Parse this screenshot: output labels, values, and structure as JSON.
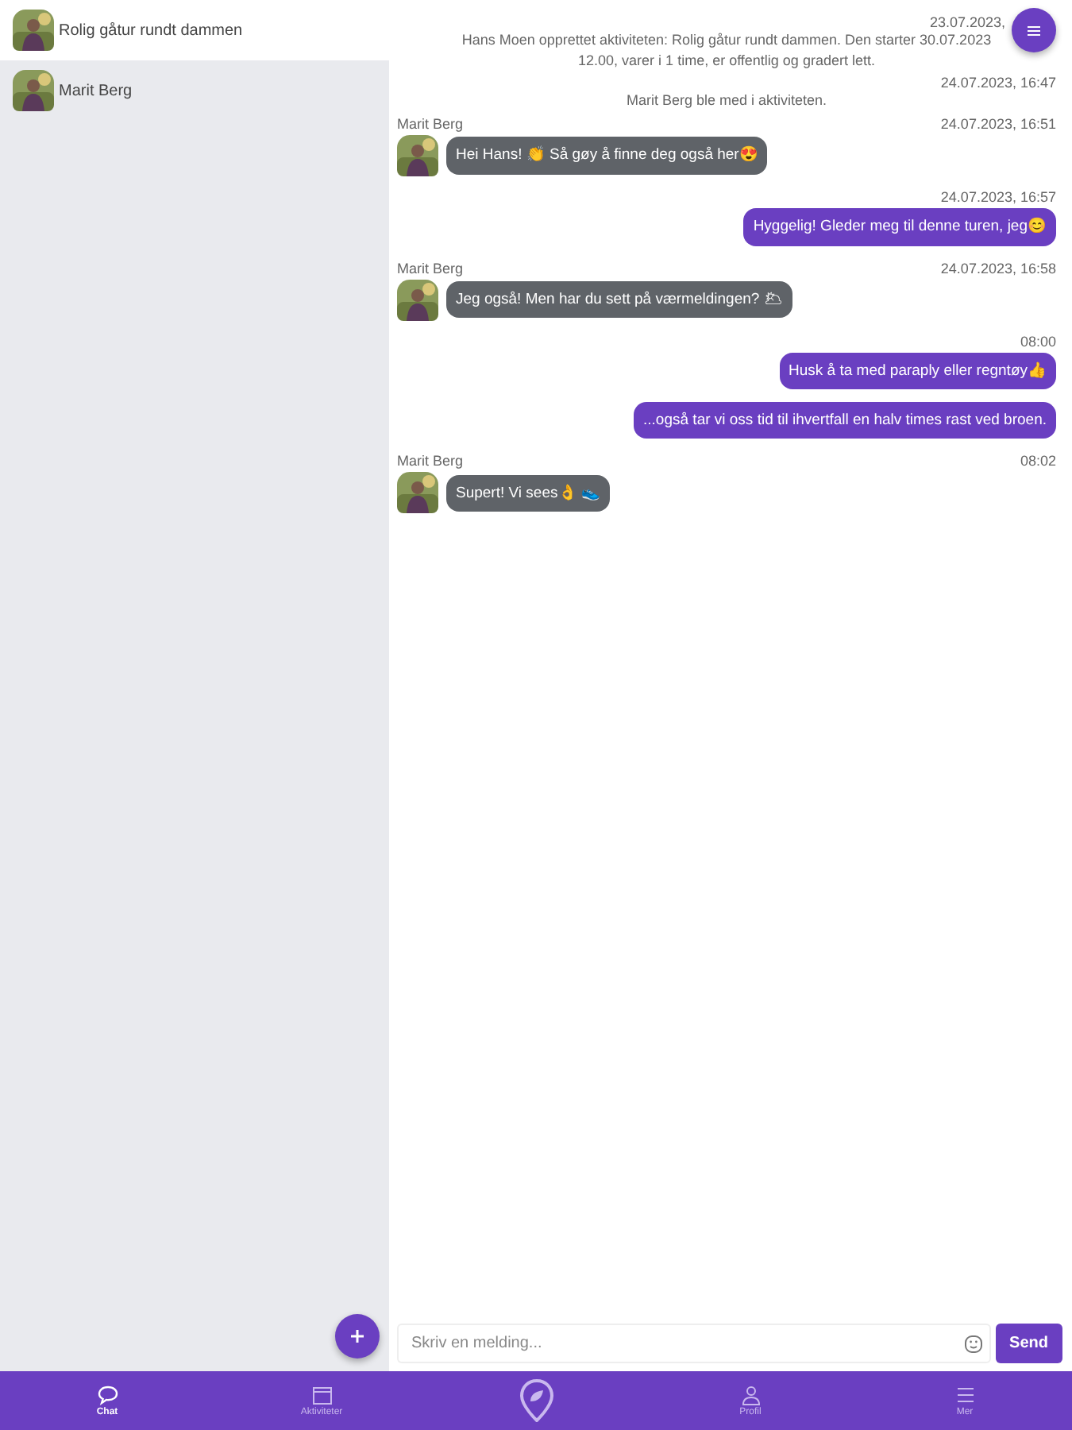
{
  "sidebar": {
    "items": [
      {
        "title": "Rolig gåtur rundt dammen",
        "selected": true
      },
      {
        "title": "Marit Berg",
        "selected": false
      }
    ]
  },
  "chat": {
    "messages": [
      {
        "kind": "system",
        "time": "23.07.2023,",
        "text": "Hans Moen opprettet aktiviteten: Rolig gåtur rundt dammen. Den starter 30.07.2023 12.00, varer i 1 time, er offentlig og gradert lett."
      },
      {
        "kind": "system",
        "time": "24.07.2023, 16:47",
        "text": "Marit Berg ble med i aktiviteten."
      },
      {
        "kind": "in",
        "sender": "Marit Berg",
        "time": "24.07.2023, 16:51",
        "text": "Hei Hans! 👏 Så gøy å finne deg også her😍"
      },
      {
        "kind": "out",
        "time": "24.07.2023, 16:57",
        "text": "Hyggelig! Gleder meg til denne turen, jeg😊"
      },
      {
        "kind": "in",
        "sender": "Marit Berg",
        "time": "24.07.2023, 16:58",
        "text": "Jeg også! Men har du sett på værmeldingen? 🌥"
      },
      {
        "kind": "out",
        "time": "08:00",
        "text": "Husk å ta med paraply eller regntøy👍"
      },
      {
        "kind": "out",
        "text": "...også tar vi oss tid til ihvertfall en halv times rast ved broen."
      },
      {
        "kind": "in",
        "sender": "Marit Berg",
        "time": "08:02",
        "text": "Supert! Vi sees👌 👟"
      }
    ]
  },
  "composer": {
    "placeholder": "Skriv en melding...",
    "send": "Send"
  },
  "nav": [
    {
      "label": "Chat",
      "selected": true
    },
    {
      "label": "Aktiviteter",
      "selected": false
    },
    {
      "selected": false
    },
    {
      "label": "Profil",
      "selected": false
    },
    {
      "label": "Mer",
      "selected": false
    }
  ]
}
